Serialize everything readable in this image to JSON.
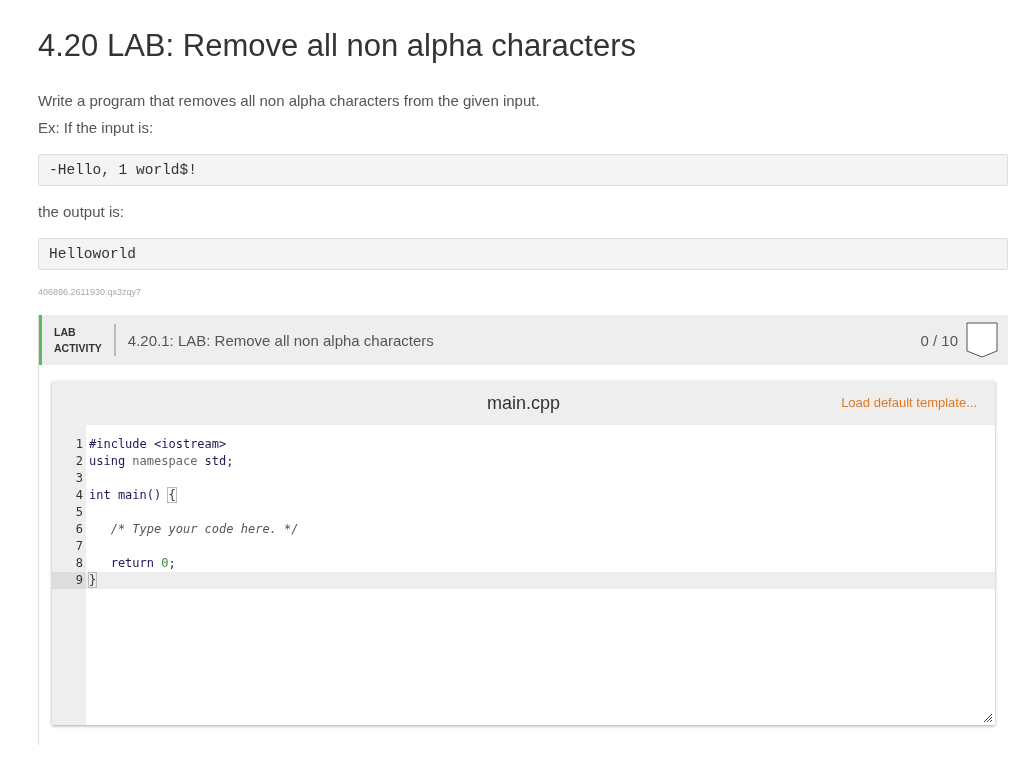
{
  "title": "4.20 LAB: Remove all non alpha characters",
  "description": "Write a program that removes all non alpha characters from the given input.",
  "example_intro": "Ex: If the input is:",
  "example_input": "-Hello, 1 world$!",
  "output_intro": "the output is:",
  "example_output": "Helloworld",
  "content_id": "406896.2611930.qx3zqy7",
  "lab": {
    "badge_line_1": "LAB",
    "badge_line_2": "ACTIVITY",
    "name": "4.20.1: LAB: Remove all non alpha characters",
    "score": "0 / 10",
    "completed": false
  },
  "editor": {
    "filename": "main.cpp",
    "load_template": "Load default template...",
    "lines": [
      {
        "number": "1",
        "active": false,
        "tokens": [
          {
            "kind": "keyword",
            "text": "#include <iostream>"
          }
        ]
      },
      {
        "number": "2",
        "active": false,
        "tokens": [
          {
            "kind": "keyword",
            "text": "using "
          },
          {
            "kind": "muted",
            "text": "namespace "
          },
          {
            "kind": "keyword",
            "text": "std;"
          }
        ]
      },
      {
        "number": "3",
        "active": false
      },
      {
        "number": "4",
        "active": false,
        "tokens": [
          {
            "kind": "keyword",
            "text": "int main() "
          },
          {
            "kind": "bracket",
            "text": "{"
          }
        ]
      },
      {
        "number": "5",
        "active": false
      },
      {
        "number": "6",
        "active": false,
        "tokens": [
          {
            "kind": "comment",
            "text": "   /* Type your code here. */"
          }
        ]
      },
      {
        "number": "7",
        "active": false
      },
      {
        "number": "8",
        "active": false,
        "tokens": [
          {
            "kind": "keyword",
            "text": "   return "
          },
          {
            "kind": "number",
            "text": "0"
          },
          {
            "kind": "keyword",
            "text": ";"
          }
        ]
      },
      {
        "number": "9",
        "active": true,
        "tokens": [
          {
            "kind": "bracket",
            "text": "}"
          }
        ]
      }
    ]
  }
}
